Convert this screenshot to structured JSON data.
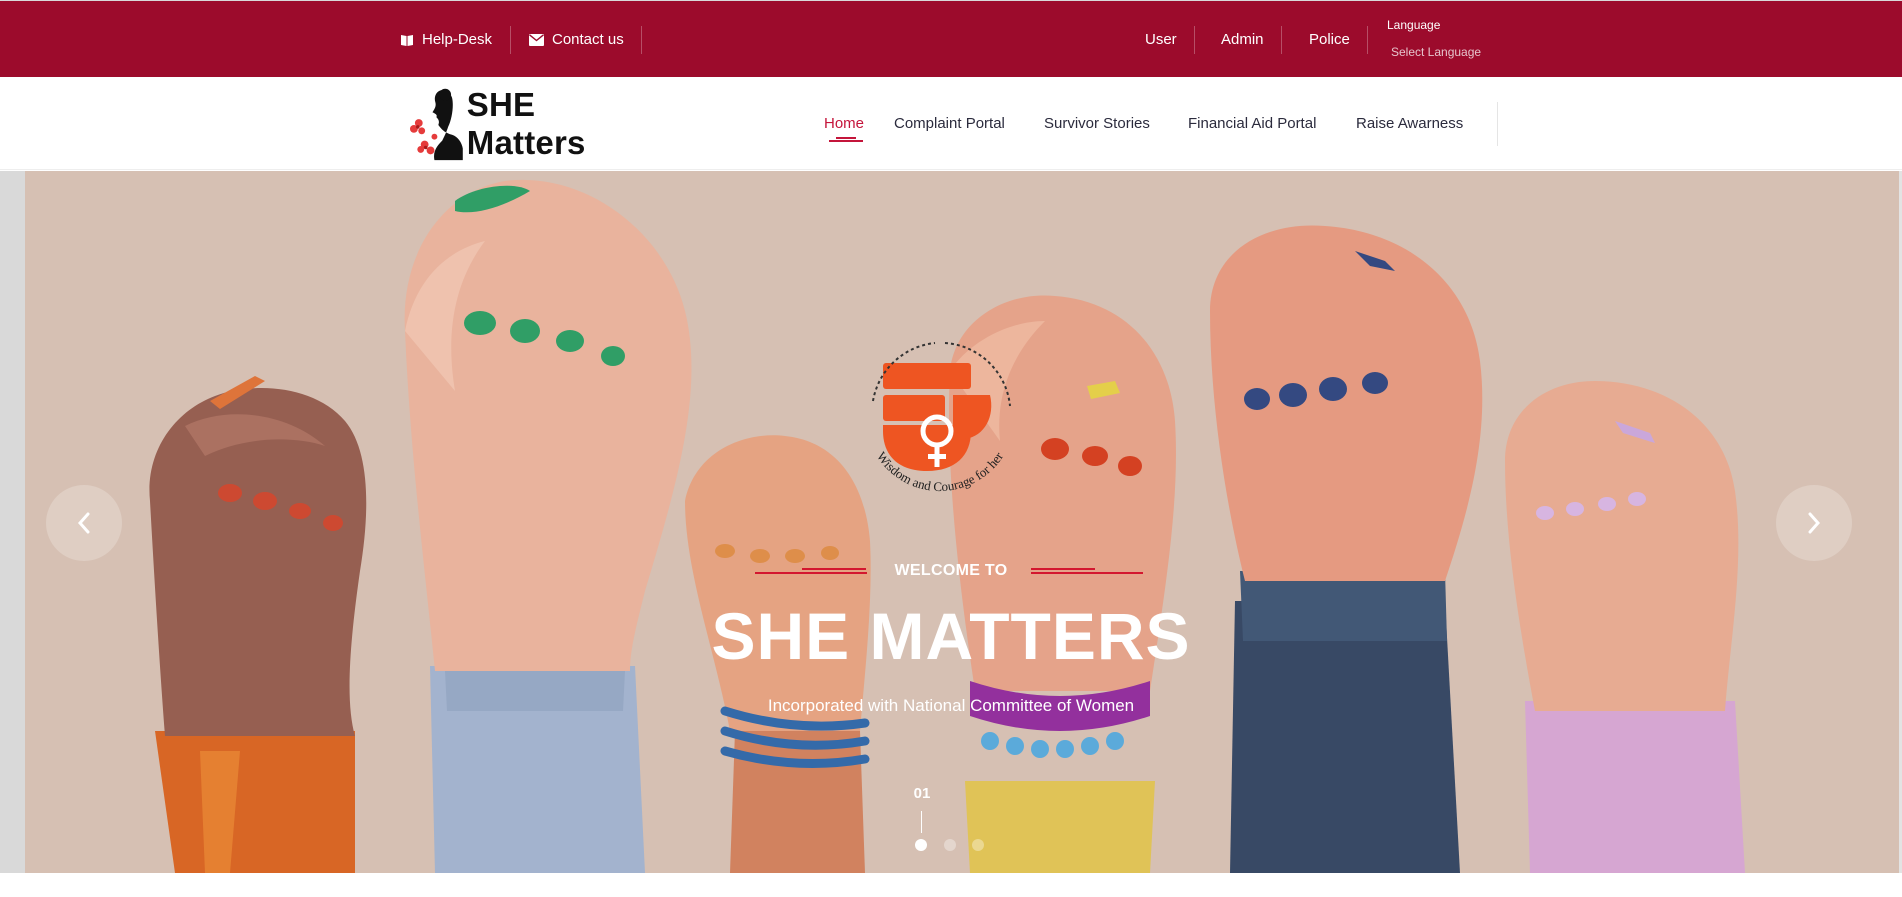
{
  "topbar": {
    "helpdesk": "Help-Desk",
    "contact": "Contact us",
    "user": "User",
    "admin": "Admin",
    "police": "Police",
    "language_title": "Language",
    "language_select": "Select Language"
  },
  "nav": {
    "logo_text": "SHE Matters",
    "items": [
      {
        "label": "Home",
        "active": true
      },
      {
        "label": "Complaint Portal",
        "active": false
      },
      {
        "label": "Survivor Stories",
        "active": false
      },
      {
        "label": "Financial Aid Portal",
        "active": false
      },
      {
        "label": "Raise Awarness",
        "active": false
      }
    ]
  },
  "hero": {
    "welcome": "WELCOME TO",
    "title": "SHE MATTERS",
    "subtitle": "Incorporated with National Committee of Women",
    "slide_number": "01",
    "slide_count": 3,
    "active_slide": 1,
    "emblem_caption": "Wisdom and Courage for her"
  },
  "colors": {
    "topbar": "#9c0b2c",
    "accent": "#c4153b",
    "hero_bg": "#d4c0b2",
    "emblem": "#ee5522"
  }
}
